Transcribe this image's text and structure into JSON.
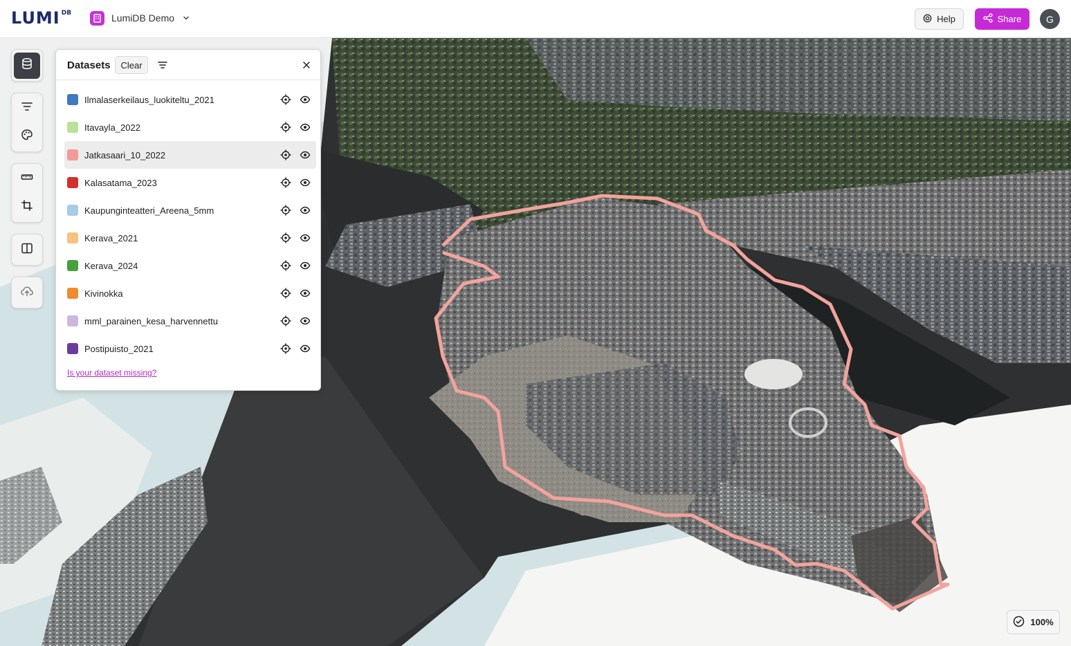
{
  "app": {
    "logo": "LUMI",
    "logo_sup": "DB",
    "project_name": "LumiDB Demo"
  },
  "header": {
    "help_label": "Help",
    "share_label": "Share",
    "avatar_initial": "G",
    "share_color": "#c52ad6"
  },
  "panel": {
    "title": "Datasets",
    "clear_label": "Clear",
    "missing_link": "Is your dataset missing?",
    "datasets": [
      {
        "label": "Ilmalaserkeilaus_luokiteltu_2021",
        "color": "#3f78c0"
      },
      {
        "label": "Itavayla_2022",
        "color": "#b8e19a"
      },
      {
        "label": "Jatkasaari_10_2022",
        "color": "#f19b98"
      },
      {
        "label": "Kalasatama_2023",
        "color": "#d2312a"
      },
      {
        "label": "Kaupunginteatteri_Areena_5mm",
        "color": "#a9cbe8"
      },
      {
        "label": "Kerava_2021",
        "color": "#f6c27f"
      },
      {
        "label": "Kerava_2024",
        "color": "#46a03c"
      },
      {
        "label": "Kivinokka",
        "color": "#f08a2d"
      },
      {
        "label": "mml_parainen_kesa_harvennettu",
        "color": "#cdb7de"
      },
      {
        "label": "Postipuisto_2021",
        "color": "#6a3d9a"
      }
    ]
  },
  "status": {
    "percent": "100%"
  },
  "icons": {
    "toolbar": [
      "database-icon",
      "filter-icon",
      "palette-icon",
      "ruler-icon",
      "crop-icon",
      "split-view-icon",
      "cloud-upload-icon"
    ]
  }
}
